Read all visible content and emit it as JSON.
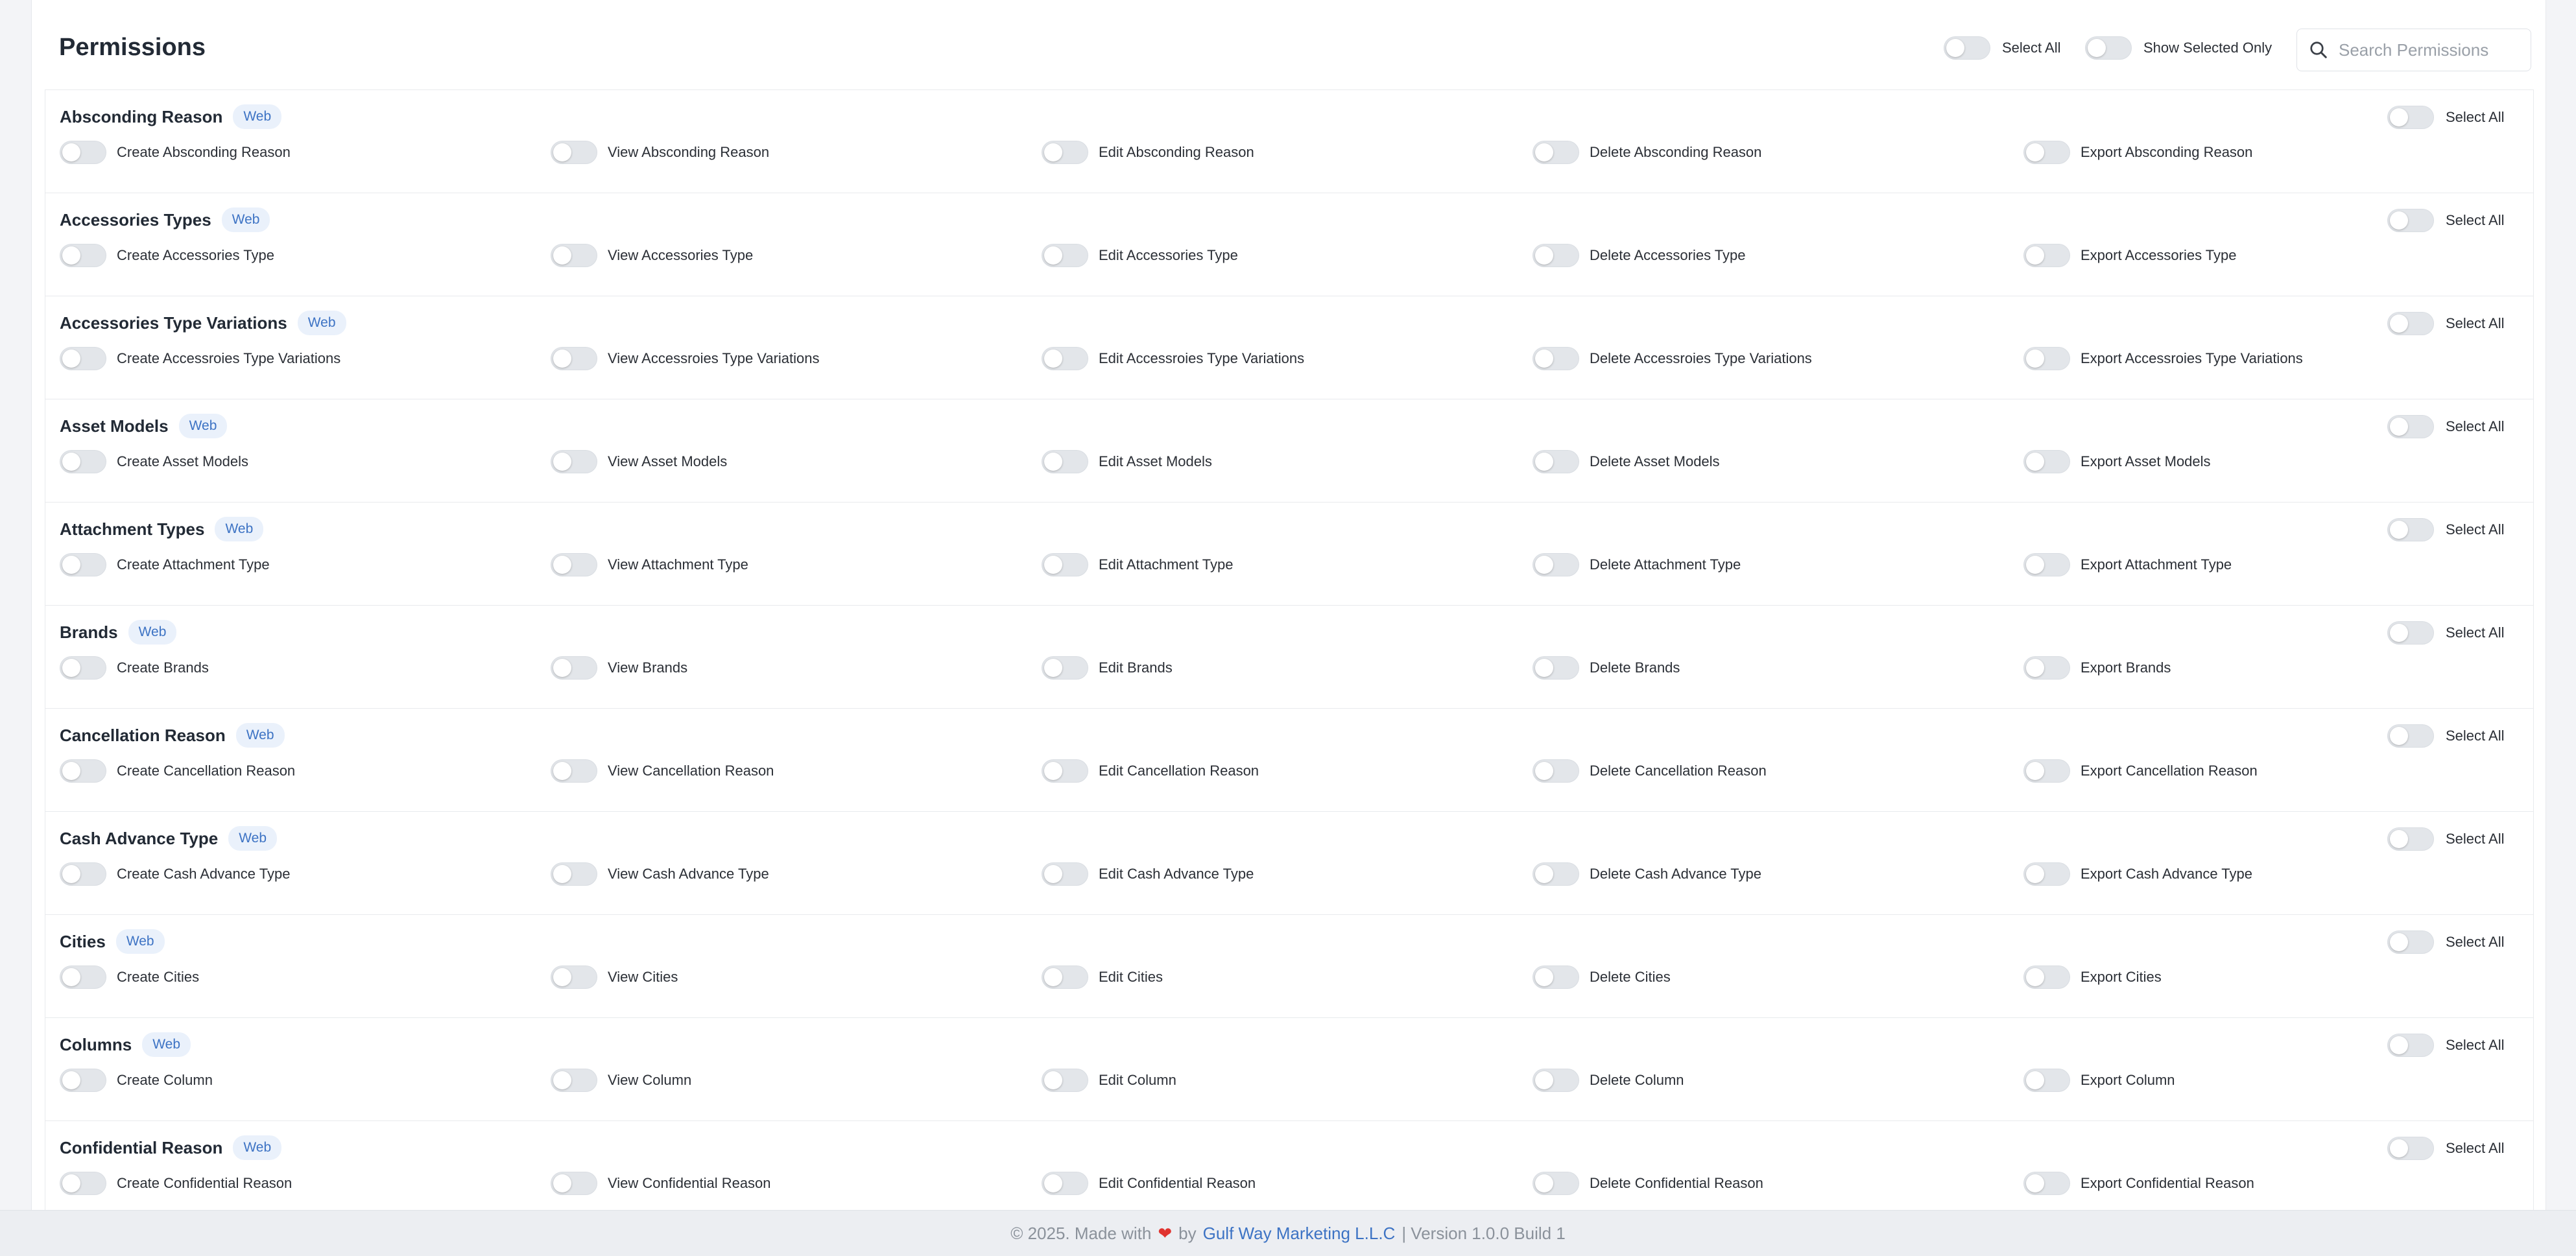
{
  "header": {
    "title": "Permissions",
    "select_all_label": "Select All",
    "show_selected_label": "Show Selected Only",
    "search_placeholder": "Search Permissions"
  },
  "group_select_all_label": "Select All",
  "groups": [
    {
      "title": "Absconding Reason",
      "badge": "Web",
      "perms": [
        "Create Absconding Reason",
        "View Absconding Reason",
        "Edit Absconding Reason",
        "Delete Absconding Reason",
        "Export Absconding Reason"
      ]
    },
    {
      "title": "Accessories Types",
      "badge": "Web",
      "perms": [
        "Create Accessories Type",
        "View Accessories Type",
        "Edit Accessories Type",
        "Delete Accessories Type",
        "Export Accessories Type"
      ]
    },
    {
      "title": "Accessories Type Variations",
      "badge": "Web",
      "perms": [
        "Create Accessroies Type Variations",
        "View Accessroies Type Variations",
        "Edit Accessroies Type Variations",
        "Delete Accessroies Type Variations",
        "Export Accessroies Type Variations"
      ]
    },
    {
      "title": "Asset Models",
      "badge": "Web",
      "perms": [
        "Create Asset Models",
        "View Asset Models",
        "Edit Asset Models",
        "Delete Asset Models",
        "Export Asset Models"
      ]
    },
    {
      "title": "Attachment Types",
      "badge": "Web",
      "perms": [
        "Create Attachment Type",
        "View Attachment Type",
        "Edit Attachment Type",
        "Delete Attachment Type",
        "Export Attachment Type"
      ]
    },
    {
      "title": "Brands",
      "badge": "Web",
      "perms": [
        "Create Brands",
        "View Brands",
        "Edit Brands",
        "Delete Brands",
        "Export Brands"
      ]
    },
    {
      "title": "Cancellation Reason",
      "badge": "Web",
      "perms": [
        "Create Cancellation Reason",
        "View Cancellation Reason",
        "Edit Cancellation Reason",
        "Delete Cancellation Reason",
        "Export Cancellation Reason"
      ]
    },
    {
      "title": "Cash Advance Type",
      "badge": "Web",
      "perms": [
        "Create Cash Advance Type",
        "View Cash Advance Type",
        "Edit Cash Advance Type",
        "Delete Cash Advance Type",
        "Export Cash Advance Type"
      ]
    },
    {
      "title": "Cities",
      "badge": "Web",
      "perms": [
        "Create Cities",
        "View Cities",
        "Edit Cities",
        "Delete Cities",
        "Export Cities"
      ]
    },
    {
      "title": "Columns",
      "badge": "Web",
      "perms": [
        "Create Column",
        "View Column",
        "Edit Column",
        "Delete Column",
        "Export Column"
      ]
    },
    {
      "title": "Confidential Reason",
      "badge": "Web",
      "perms": [
        "Create Confidential Reason",
        "View Confidential Reason",
        "Edit Confidential Reason",
        "Delete Confidential Reason",
        "Export Confidential Reason"
      ]
    }
  ],
  "footer": {
    "prefix": "© 2025. Made with",
    "heart": "❤",
    "by": "by",
    "company": "Gulf Way Marketing L.L.C",
    "version": "| Version 1.0.0 Build 1"
  }
}
